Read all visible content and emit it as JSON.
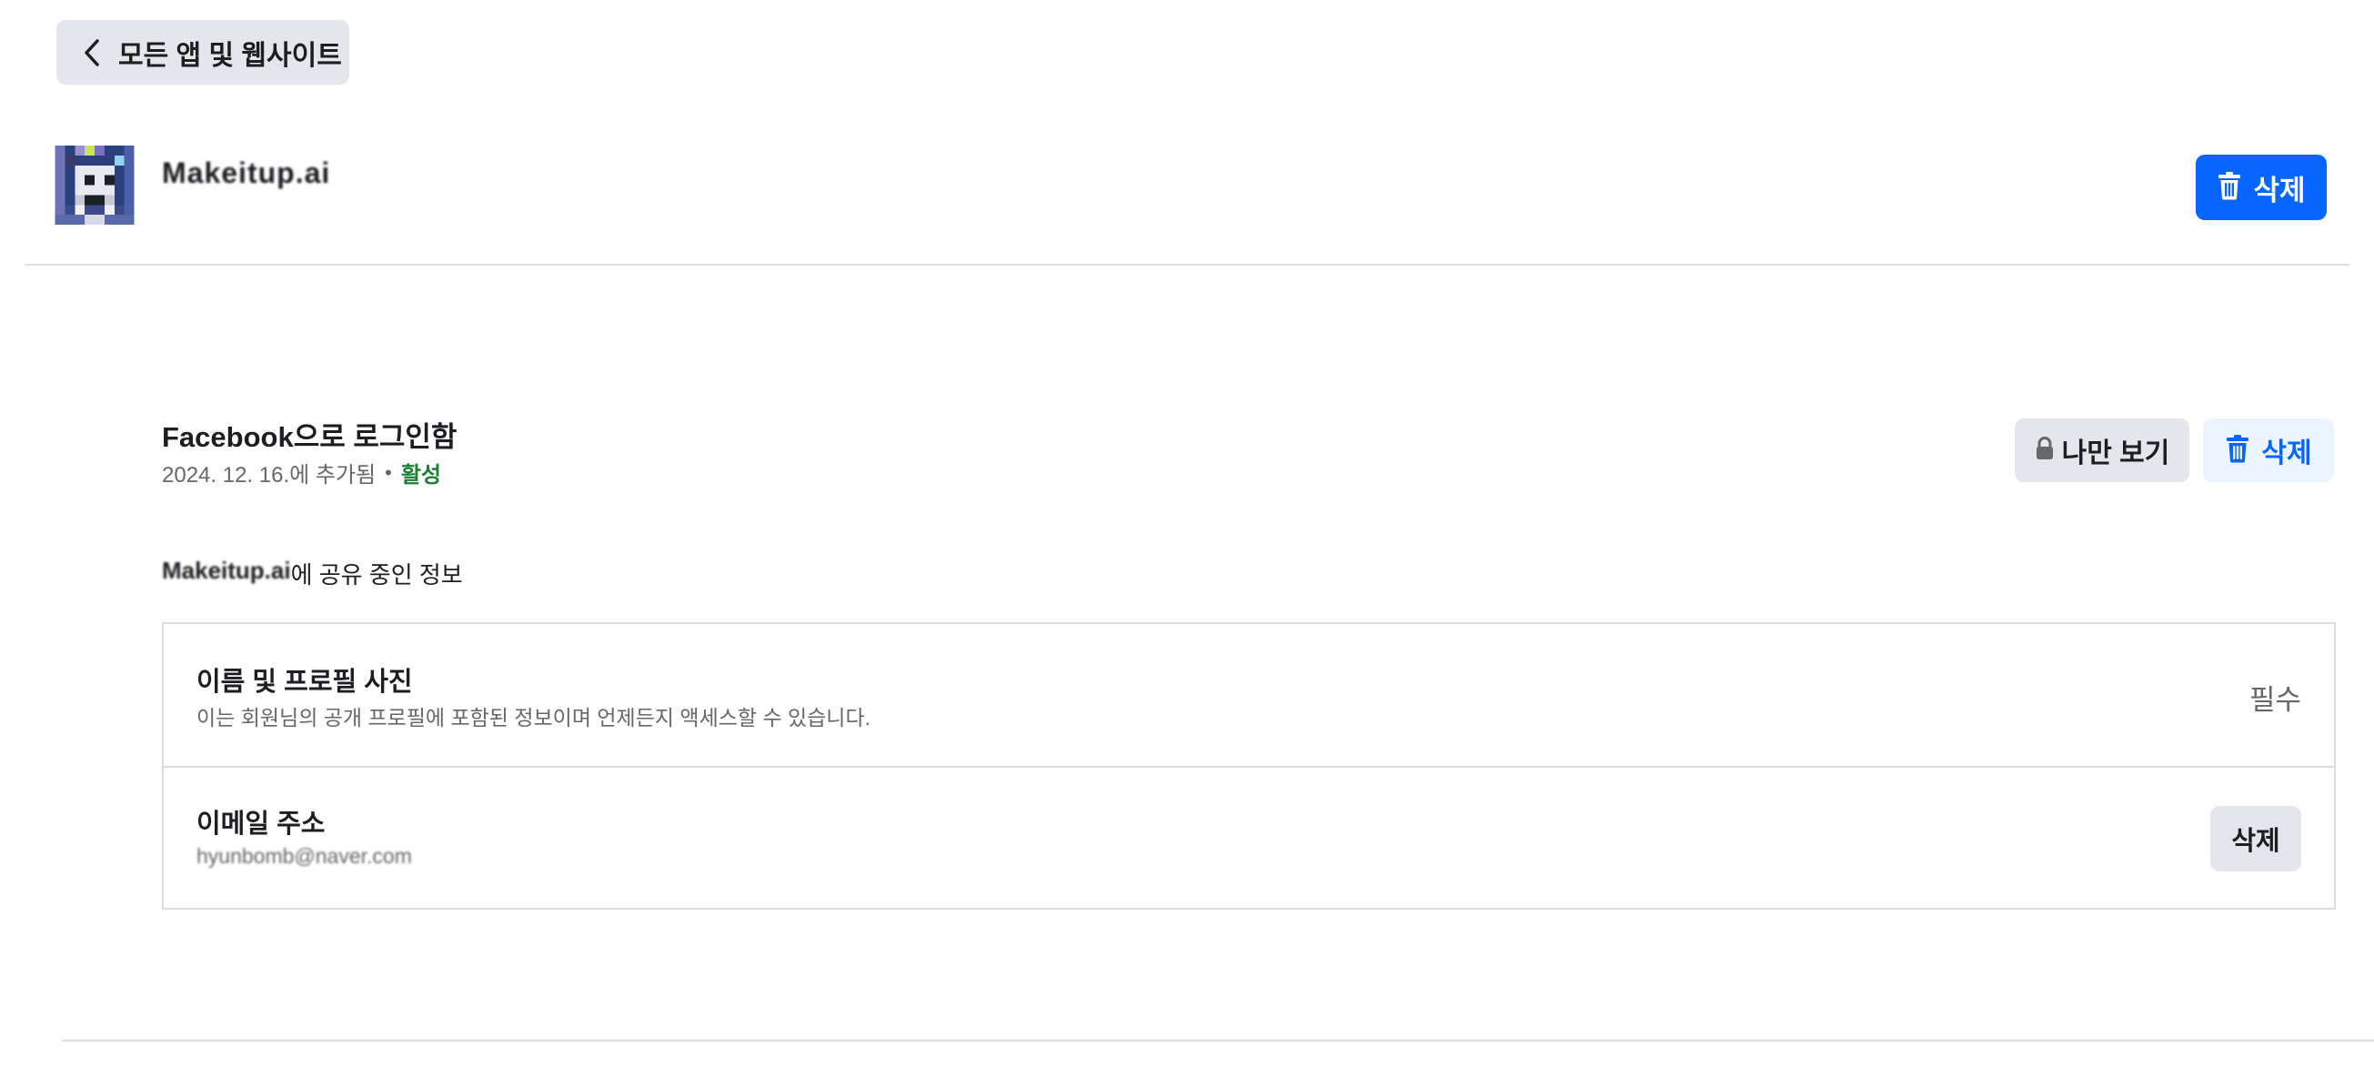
{
  "nav": {
    "back_label": "모든 앱 및 웹사이트"
  },
  "app": {
    "name": "Makeitup.ai",
    "delete_label": "삭제"
  },
  "login": {
    "title": "Facebook으로 로그인함",
    "added_date": "2024. 12. 16.에 추가됨",
    "separator": "•",
    "status": "활성",
    "status_color": "#1e7e34",
    "visibility_label": "나만 보기",
    "delete_label": "삭제"
  },
  "shared": {
    "app_name": "Makeitup.ai",
    "heading_suffix": "에 공유 중인 정보",
    "items": [
      {
        "title": "이름 및 프로필 사진",
        "description": "이는 회원님의 공개 프로필에 포함된 정보이며 언제든지 액세스할 수 있습니다.",
        "action_label": "필수"
      },
      {
        "title": "이메일 주소",
        "description": "hyunbomb@naver.com",
        "action_label": "삭제"
      }
    ]
  },
  "colors": {
    "primary": "#0866ff",
    "secondary_button_bg": "#e4e6eb",
    "light_blue_bg": "#ebf5ff",
    "divider": "#dadde1"
  },
  "icons": {
    "back": "chevron-left-icon",
    "trash": "trash-icon",
    "lock": "lock-icon"
  }
}
